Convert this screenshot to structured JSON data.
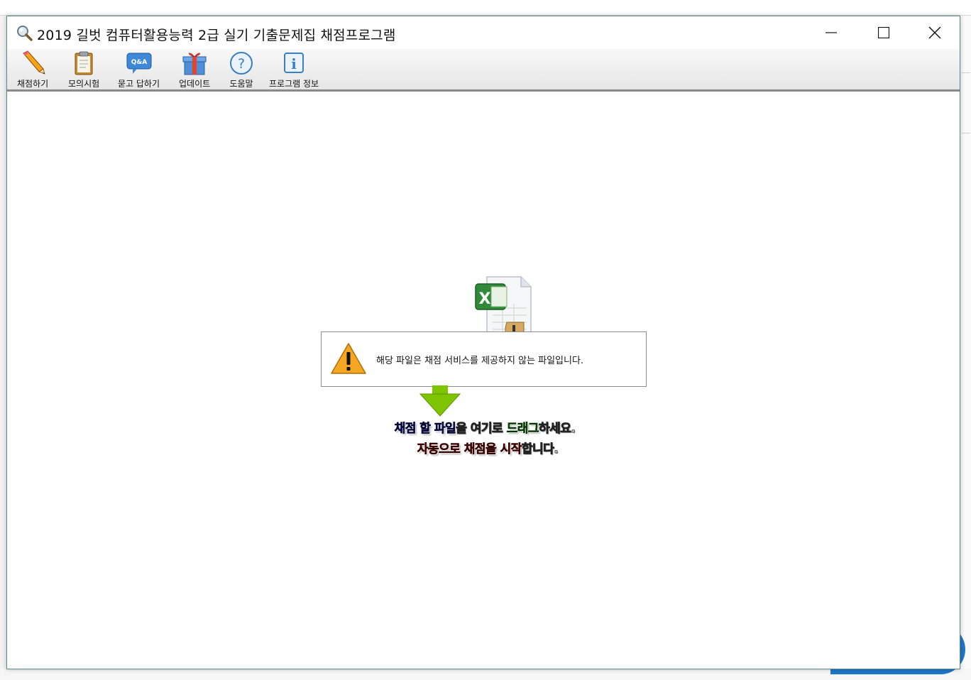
{
  "window": {
    "title": "2019 길벗 컴퓨터활용능력 2급 실기 기출문제집 채점프로그램",
    "controls": {
      "minimize": "minimize-icon",
      "maximize": "maximize-icon",
      "close": "close-icon"
    }
  },
  "toolbar": {
    "items": [
      {
        "label": "채점하기",
        "icon": "pencil-icon"
      },
      {
        "label": "모의시험",
        "icon": "clipboard-icon"
      },
      {
        "label": "묻고 답하기",
        "icon": "qa-icon",
        "badge": "Q&A"
      },
      {
        "label": "업데이트",
        "icon": "gift-icon"
      },
      {
        "label": "도움말",
        "icon": "help-icon",
        "glyph": "?"
      },
      {
        "label": "프로그램 정보",
        "icon": "info-icon",
        "glyph": "i"
      }
    ]
  },
  "dialog": {
    "message": "해당 파일은 채점 서비스를 제공하지 않는 파일입니다.",
    "icon": "warning-icon"
  },
  "dropzone": {
    "line1": [
      {
        "text": "채점 할 파일",
        "style": "blue"
      },
      {
        "text": "을 여기로 ",
        "style": "white"
      },
      {
        "text": "드래그",
        "style": "green"
      },
      {
        "text": "하세요.",
        "style": "white"
      }
    ],
    "line2": [
      {
        "text": "자동으로 채점을 시작",
        "style": "red"
      },
      {
        "text": "합니다.",
        "style": "white"
      }
    ]
  },
  "colors": {
    "accent_blue": "#1a8fe0",
    "accent_green": "#7bc800",
    "accent_red": "#e00000",
    "warning": "#f5a623"
  }
}
